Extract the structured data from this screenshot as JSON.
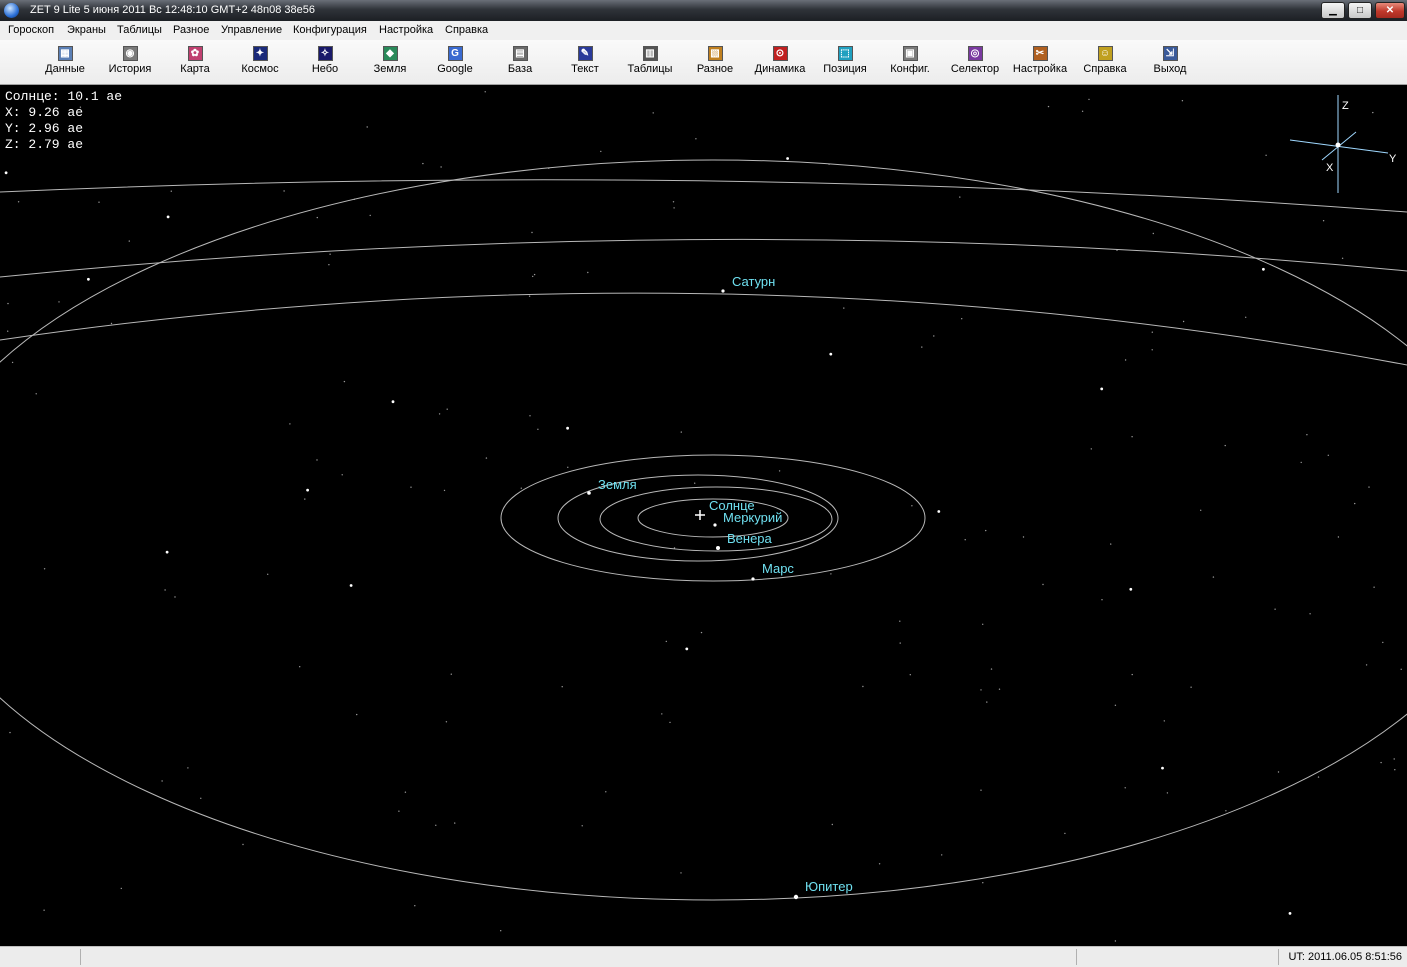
{
  "window": {
    "title": "ZET 9 Lite    5 июня 2011  Вс  12:48:10 GMT+2 48n08  38e56",
    "buttons": {
      "minimize": "▁",
      "maximize": "□",
      "close": "✕"
    }
  },
  "menu": [
    "Гороскоп",
    "Экраны",
    "Таблицы",
    "Разное",
    "Управление",
    "Конфигурация",
    "Настройка",
    "Справка"
  ],
  "toolbar": [
    {
      "label": "Данные",
      "icon": "data-grid-icon",
      "color": "#5b7fb5"
    },
    {
      "label": "История",
      "icon": "history-disk-icon",
      "color": "#7a7a7a"
    },
    {
      "label": "Карта",
      "icon": "chart-wheel-icon",
      "color": "#c04070"
    },
    {
      "label": "Космос",
      "icon": "cosmos-icon",
      "color": "#1a2a7a"
    },
    {
      "label": "Небо",
      "icon": "sky-icon",
      "color": "#1a1a6a"
    },
    {
      "label": "Земля",
      "icon": "earth-icon",
      "color": "#2a8a5a"
    },
    {
      "label": "Google",
      "icon": "google-icon",
      "color": "#3a6ad0"
    },
    {
      "label": "База",
      "icon": "database-icon",
      "color": "#6a6a6a"
    },
    {
      "label": "Текст",
      "icon": "text-icon",
      "color": "#2a3a9a"
    },
    {
      "label": "Таблицы",
      "icon": "tables-icon",
      "color": "#555555"
    },
    {
      "label": "Разное",
      "icon": "misc-icon",
      "color": "#c08020"
    },
    {
      "label": "Динамика",
      "icon": "dynamics-icon",
      "color": "#c02020"
    },
    {
      "label": "Позиция",
      "icon": "position-icon",
      "color": "#20a0c0"
    },
    {
      "label": "Конфиг.",
      "icon": "config-icon",
      "color": "#7a7a7a"
    },
    {
      "label": "Селектор",
      "icon": "selector-icon",
      "color": "#7a3aa0"
    },
    {
      "label": "Настройка",
      "icon": "settings-tools-icon",
      "color": "#b06020"
    },
    {
      "label": "Справка",
      "icon": "help-icon",
      "color": "#c0a020"
    },
    {
      "label": "Выход",
      "icon": "exit-icon",
      "color": "#3a5a9a"
    }
  ],
  "info_lines": [
    "Солнце: 10.1 ае",
    "X: 9.26 ае",
    "Y: 2.96 ае",
    "Z: 2.79 ае"
  ],
  "axes": {
    "x": "X",
    "y": "Y",
    "z": "Z"
  },
  "bodies": {
    "sun": "Солнце",
    "mercury": "Меркурий",
    "venus": "Венера",
    "earth": "Земля",
    "mars": "Марс",
    "jupiter": "Юпитер",
    "saturn": "Сатурн"
  },
  "colors": {
    "label": "#6fe0f0",
    "orbit": "#b8b8b8",
    "background": "#000000"
  },
  "status": {
    "ut": "UT: 2011.06.05  8:51:56"
  }
}
